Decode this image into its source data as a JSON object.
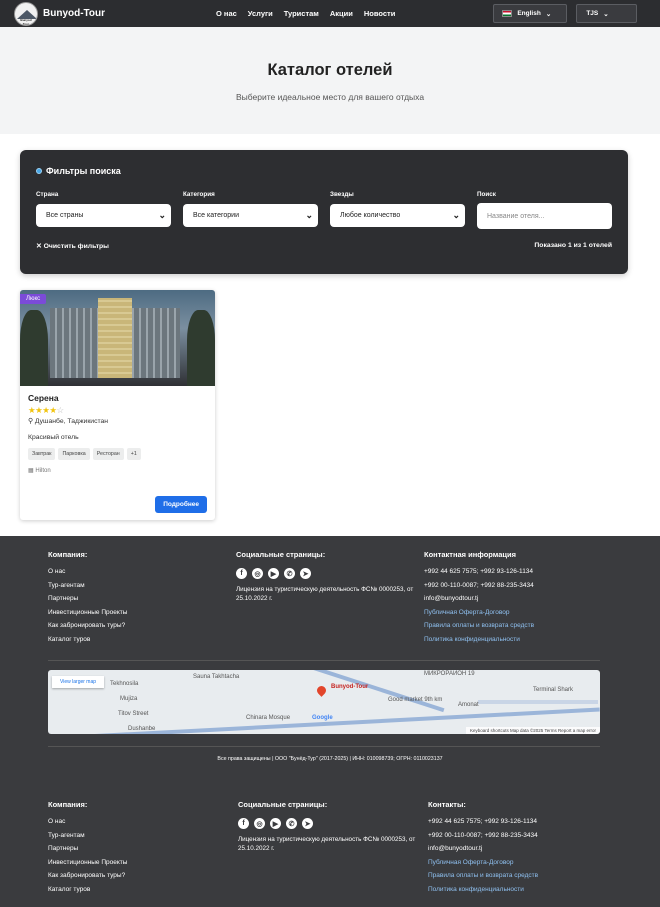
{
  "header": {
    "brand": "Bunyod-Tour",
    "logo_text": "Bunyod Tour",
    "nav": [
      "О нас",
      "Услуги",
      "Туристам",
      "Акции",
      "Новости"
    ],
    "language": "English",
    "currency": "TJS"
  },
  "hero": {
    "title": "Каталог отелей",
    "subtitle": "Выберите идеальное место для вашего отдыха"
  },
  "filters": {
    "title": "Фильтры поиска",
    "country_label": "Страна",
    "country_value": "Все страны",
    "category_label": "Категория",
    "category_value": "Все категории",
    "stars_label": "Звезды",
    "stars_value": "Любое количество",
    "search_label": "Поиск",
    "search_placeholder": "Название отеля...",
    "clear": "✕ Очистить фильтры",
    "shown": "Показано 1 из 1 отелей"
  },
  "hotel": {
    "badge": "Люкс",
    "name": "Серена",
    "rating": 4,
    "rating_max": 5,
    "location": "Душанбе, Таджикистан",
    "description": "Красивый отель",
    "tags": [
      "Завтрак",
      "Парковка",
      "Ресторан",
      "+1"
    ],
    "brand": "Hilton",
    "button": "Подробнее"
  },
  "footer": {
    "company_title": "Компания:",
    "company_links": [
      "О нас",
      "Тур-агентам",
      "Партнеры",
      "Инвестиционные Проекты",
      "Как забронировать туры?",
      "Каталог туров"
    ],
    "social_title": "Социальные страницы:",
    "license": "Лицензия на туристическую деятельность ФС№ 0000253, от 25.10.2022 г.",
    "contact_title": "Контактная информация",
    "contact_title_2": "Контакты:",
    "phone1": "+992 44 625 7575; +992 93-126-1134",
    "phone2": "+992 00-110-0087; +992 88-235-3434",
    "email": "info@bunyodtour.tj",
    "offer": "Публичная Оферта-Договор",
    "payment": "Правила оплаты и возврата средств",
    "privacy": "Политика конфиденциальности",
    "copyright": "Все права защищены | ООО \"Бунёд-Тур\" (2017-2025) | ИНН: 010098739; ОГРН: 0110023137",
    "map": {
      "view_larger": "View larger map",
      "pin_title": "Bunyod-Tour",
      "labels": [
        "Sauna Takhtacha",
        "Tekhnosila",
        "Mujiza",
        "Dushanbe",
        "Chinara Mosque",
        "Good market 9th km",
        "Amonat",
        "Terminal Shark",
        "МИКРОРАЙОН 19",
        "Titov Street"
      ],
      "google": "Google",
      "attribution": "Keyboard shortcuts   Map data ©2025   Terms   Report a map error"
    }
  }
}
